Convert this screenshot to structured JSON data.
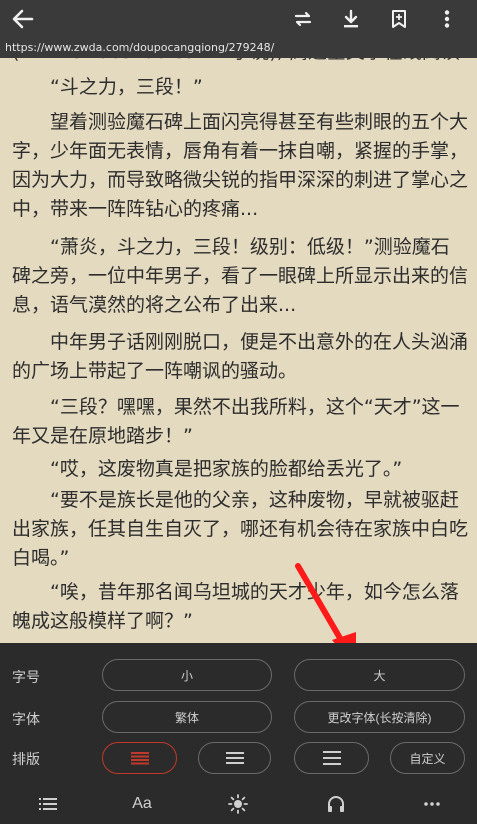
{
  "url": "https://www.zwda.com/doupocangqiong/279248/",
  "content": {
    "top_partial_line": "(www.exiaoshuo.com E小说), 高速全文字在线阅读!",
    "paragraphs": [
      "“斗之力，三段！”",
      "望着测验魔石碑上面闪亮得甚至有些刺眼的五个大字，少年面无表情，唇角有着一抹自嘲，紧握的手掌，因为大力，而导致略微尖锐的指甲深深的刺进了掌心之中，带来一阵阵钻心的疼痛...",
      "“萧炎，斗之力，三段！级别：低级！”测验魔石碑之旁，一位中年男子，看了一眼碑上所显示出来的信息，语气漠然的将之公布了出来...",
      "中年男子话刚刚脱口，便是不出意外的在人头汹涌的广场上带起了一阵嘲讽的骚动。",
      "“三段？嘿嘿，果然不出我所料，这个“天才”这一年又是在原地踏步！”",
      "“哎，这废物真是把家族的脸都给丢光了。”",
      "“要不是族长是他的父亲，这种废物，早就被驱赶出家族，任其自生自灭了，哪还有机会待在家族中白吃白喝。”",
      "“唉，昔年那名闻乌坦城的天才少年，如今怎么落魄成这般模样了啊？”"
    ]
  },
  "settings": {
    "font_size_label": "字号",
    "font_small": "小",
    "font_large": "大",
    "font_face_label": "字体",
    "font_traditional": "繁体",
    "change_font": "更改字体(长按清除)",
    "layout_label": "排版",
    "custom": "自定义"
  },
  "colors": {
    "reader_bg": "#e4dac0",
    "accent": "#c0392b",
    "arrow": "#ff1a1a",
    "bar_bg": "#3a3a3a",
    "panel_bg": "#2b2b2b"
  },
  "icons": {
    "top": [
      "back-arrow-icon",
      "swap-icon",
      "download-icon",
      "bookmark-icon",
      "more-vertical-icon"
    ],
    "bottom": [
      "list-icon",
      "font-aa-icon",
      "brightness-icon",
      "headphones-icon",
      "more-horizontal-icon"
    ]
  },
  "bottom_nav": {
    "aa_label": "Aa"
  }
}
